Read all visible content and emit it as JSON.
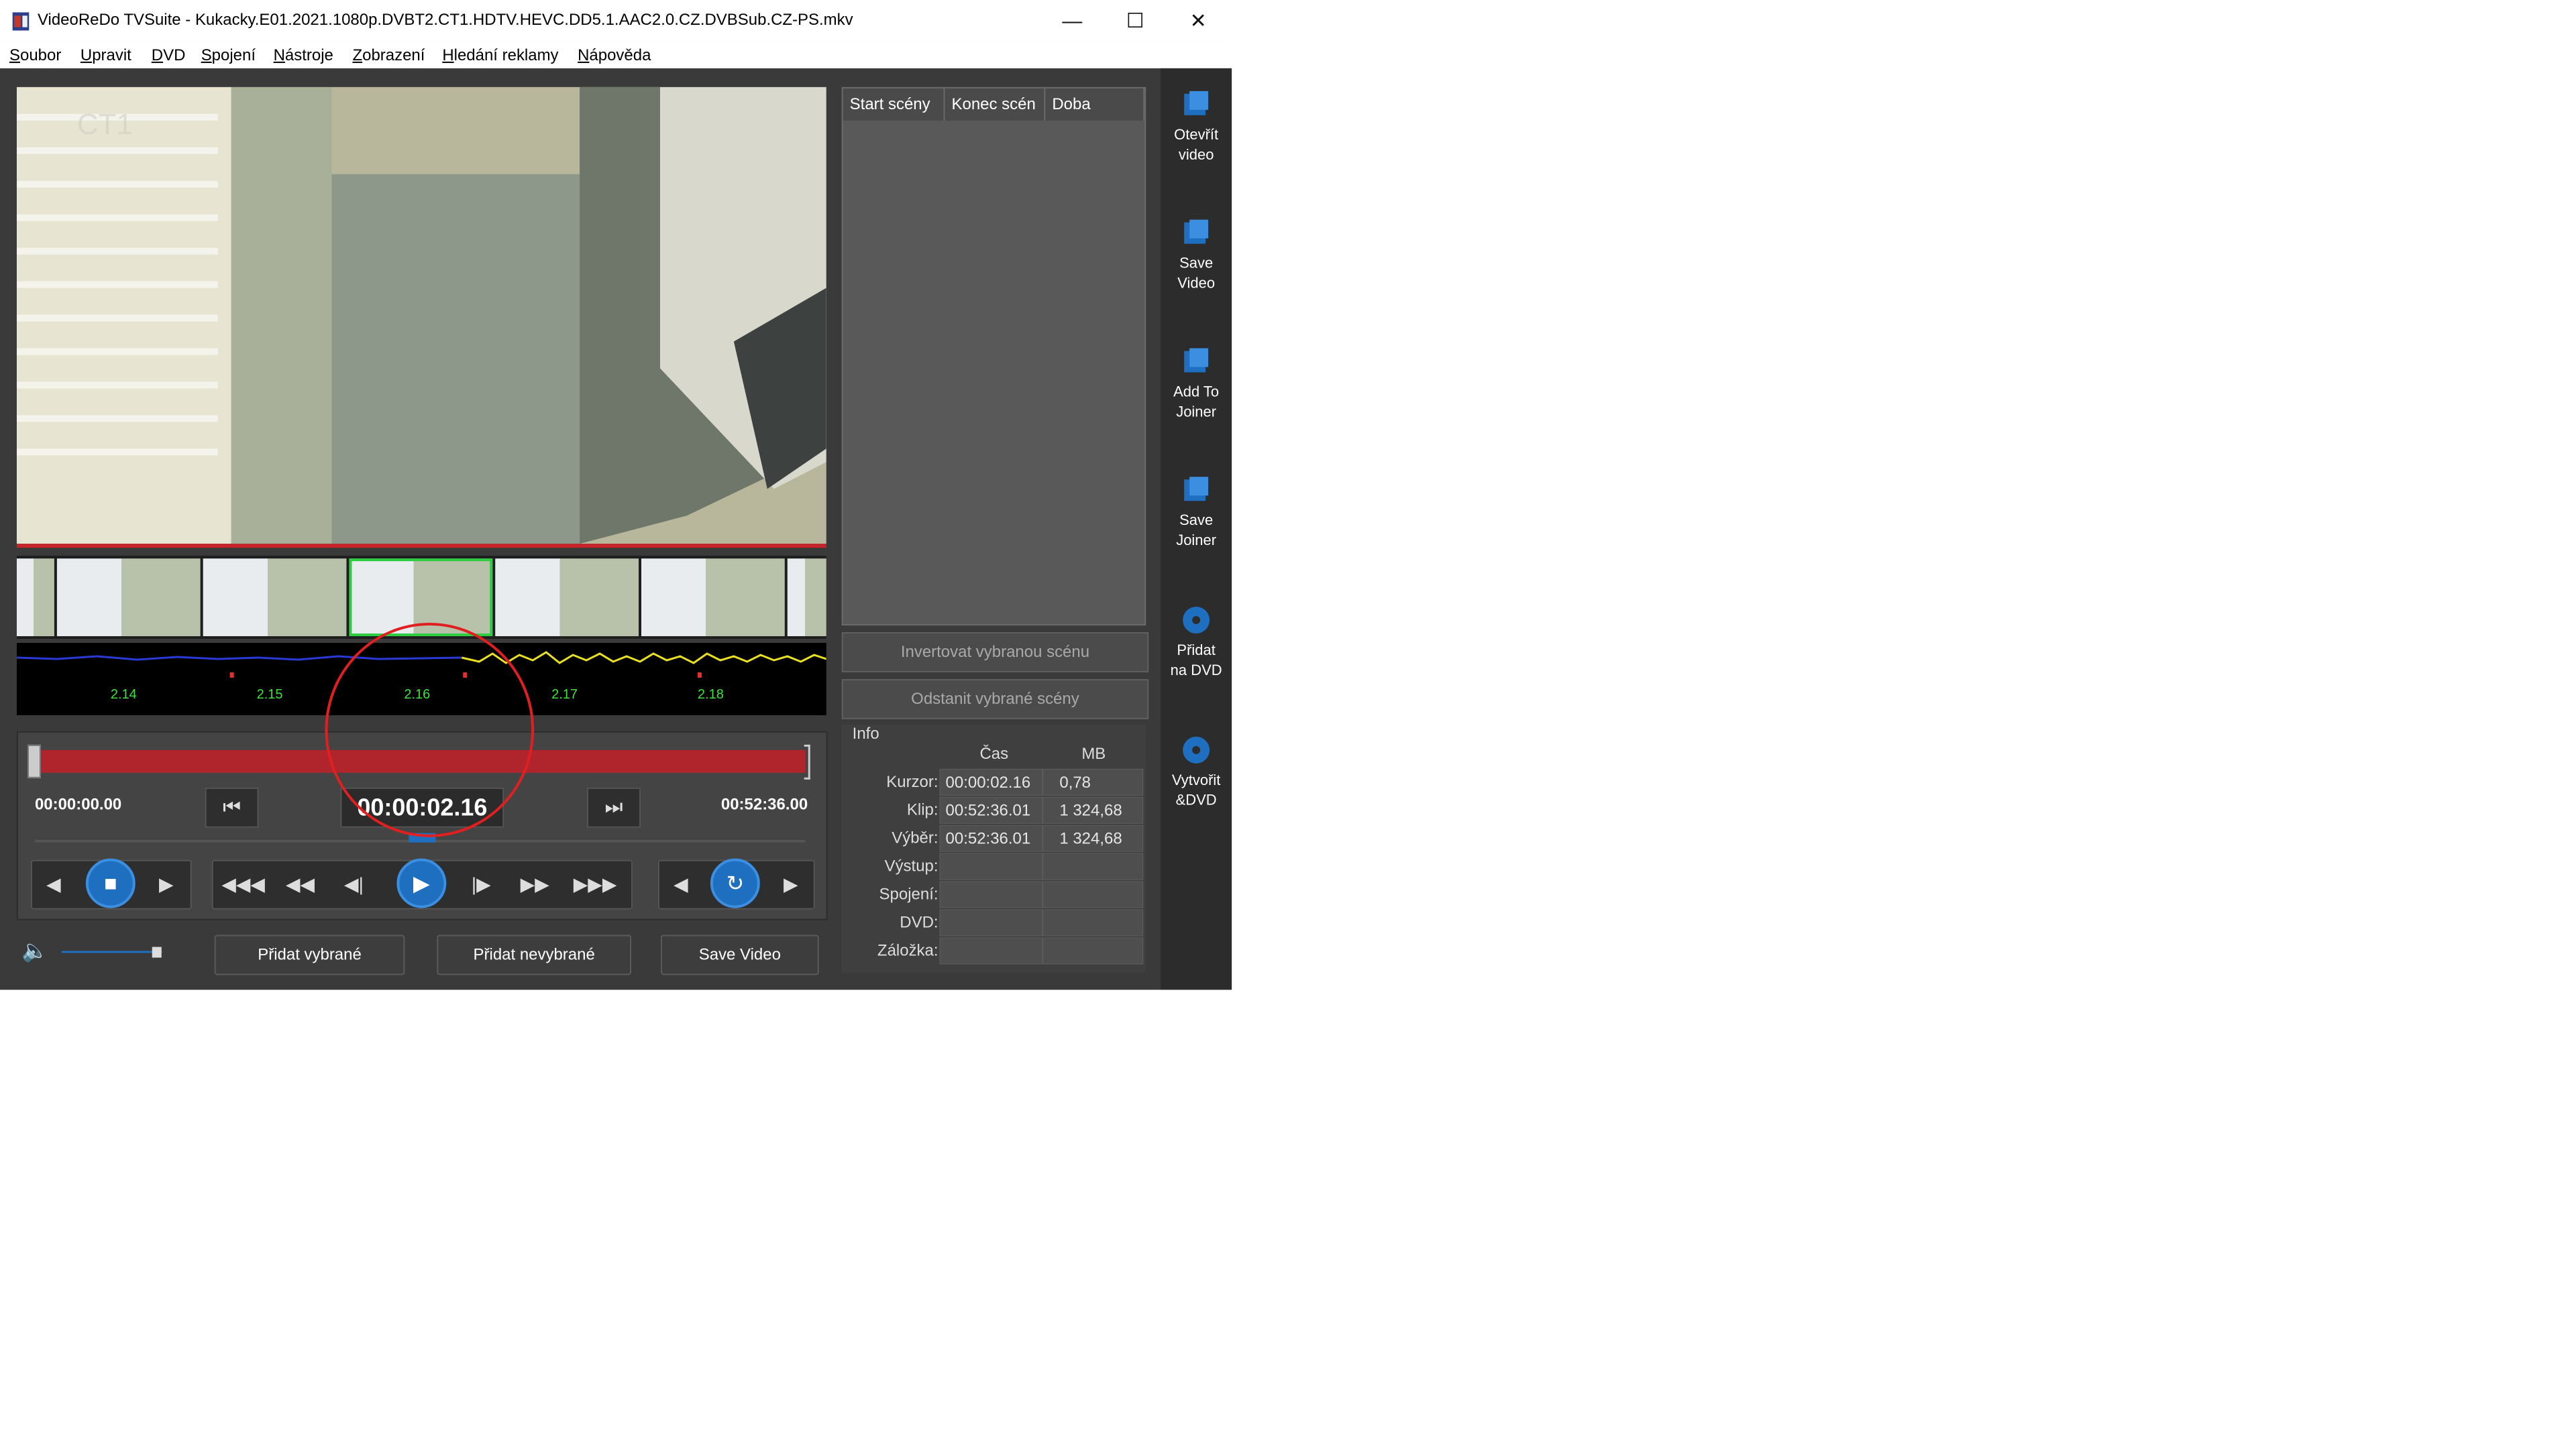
{
  "window": {
    "title": "VideoReDo TVSuite - Kukacky.E01.2021.1080p.DVBT2.CT1.HDTV.HEVC.DD5.1.AAC2.0.CZ.DVBSub.CZ-PS.mkv",
    "controls": [
      "—",
      "☐",
      "✕"
    ]
  },
  "menu": [
    "Soubor",
    "Upravit",
    "DVD",
    "Spojení",
    "Nástroje",
    "Zobrazení",
    "Hledání reklamy",
    "Nápověda"
  ],
  "waveform_labels": [
    "2.14",
    "2.15",
    "2.16",
    "2.17",
    "2.18"
  ],
  "timeline": {
    "start": "00:00:00.00",
    "current": "00:00:02.16",
    "end": "00:52:36.00",
    "position_fraction": 0.0007
  },
  "buttons": {
    "add_selected": "Přidat vybrané",
    "add_unselected": "Přidat nevybrané",
    "save_video": "Save Video",
    "invert_scene": "Invertovat vybranou scénu",
    "remove_scenes": "Odstanit vybrané scény"
  },
  "scene_list": {
    "headers": [
      "Start scény",
      "Konec scén",
      "Doba"
    ]
  },
  "info": {
    "title": "Info",
    "columns": [
      "Čas",
      "MB"
    ],
    "rows": [
      {
        "label": "Kurzor:",
        "time": "00:00:02.16",
        "mb": "0,78"
      },
      {
        "label": "Klip:",
        "time": "00:52:36.01",
        "mb": "1 324,68"
      },
      {
        "label": "Výběr:",
        "time": "00:52:36.01",
        "mb": "1 324,68"
      },
      {
        "label": "Výstup:",
        "time": "",
        "mb": ""
      },
      {
        "label": "Spojení:",
        "time": "",
        "mb": ""
      },
      {
        "label": "DVD:",
        "time": "",
        "mb": ""
      },
      {
        "label": "Záložka:",
        "time": "",
        "mb": ""
      }
    ]
  },
  "sidebar": [
    {
      "line1": "Otevřít",
      "line2": "video",
      "icon": "open-video-icon"
    },
    {
      "line1": "Save",
      "line2": "Video",
      "icon": "save-video-icon"
    },
    {
      "line1": "Add To",
      "line2": "Joiner",
      "icon": "add-to-joiner-icon"
    },
    {
      "line1": "Save",
      "line2": "Joiner",
      "icon": "save-joiner-icon"
    },
    {
      "line1": "Přidat",
      "line2": "na DVD",
      "icon": "add-dvd-icon"
    },
    {
      "line1": "Vytvořit",
      "line2": "&DVD",
      "icon": "create-dvd-icon"
    }
  ],
  "volume_level": 0.9,
  "colors": {
    "accent_blue": "#1f6fc0",
    "timeline_red": "#b0252b",
    "waveform_label_green": "#3de33d"
  }
}
